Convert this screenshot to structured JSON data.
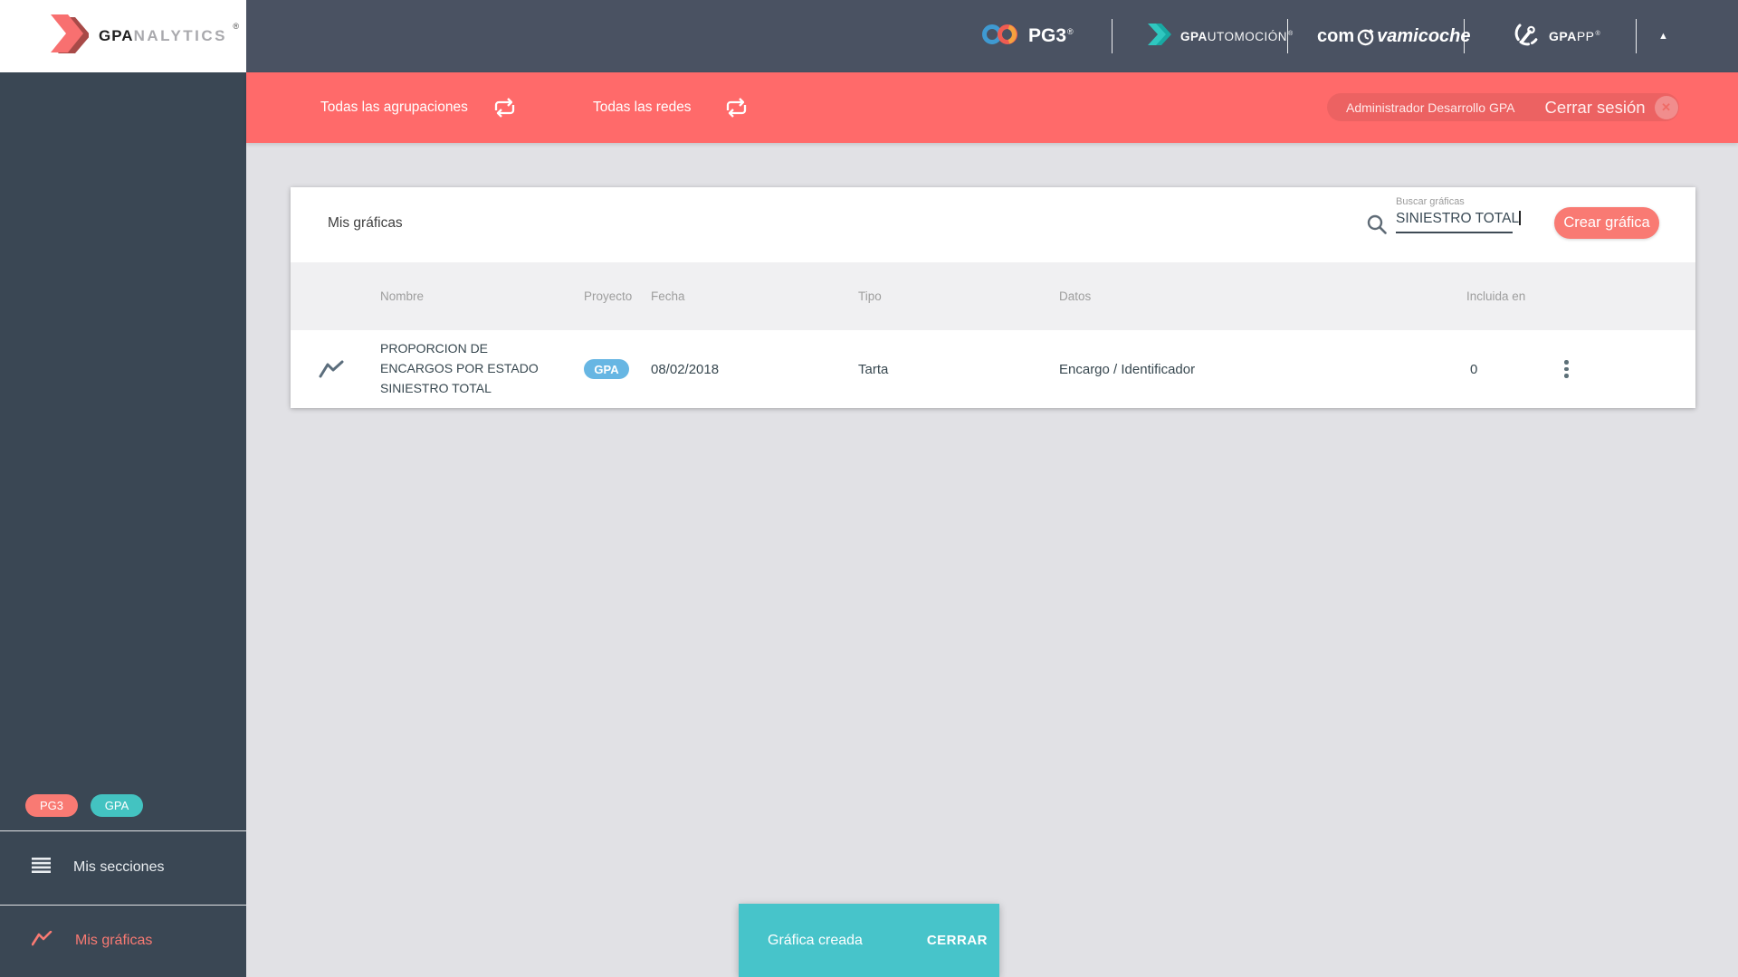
{
  "colors": {
    "coral": "#f97a73",
    "red": "#ff6a6a",
    "teal": "#43c3c1",
    "teal2": "#47c4ca",
    "blue": "#67b6e3"
  },
  "brand": {
    "gpa": "GPA",
    "nalytics": "NALYTICS",
    "reg": "®"
  },
  "topbar": {
    "pg3": "PG3",
    "pg3_reg": "®",
    "gpauto_bold": "GPA",
    "gpauto_thin": "UTOMOCIÓN",
    "gpauto_reg": "®",
    "comprava_pre": "com",
    "comprava_post": "vamicoche",
    "gpapp_bold": "GPA",
    "gpapp_thin": "PP",
    "gpapp_reg": "®",
    "collapse_icon": "▲"
  },
  "filterbar": {
    "groupings_label": "Todas las agrupaciones",
    "networks_label": "Todas las redes",
    "user_name": "Administrador Desarrollo GPA",
    "logout_label": "Cerrar sesión",
    "close_x": "✕"
  },
  "sidebar": {
    "badges": [
      {
        "label": "PG3"
      },
      {
        "label": "GPA"
      }
    ],
    "items": [
      {
        "label": "Mis secciones"
      },
      {
        "label": "Mis gráficas"
      }
    ]
  },
  "main": {
    "title": "Mis gráficas",
    "search": {
      "label": "Buscar gráficas",
      "value": "SINIESTRO TOTAL"
    },
    "create_button": "Crear gráfica",
    "table": {
      "headers": [
        "Nombre",
        "Proyecto",
        "Fecha",
        "Tipo",
        "Datos",
        "Incluida en"
      ],
      "rows": [
        {
          "name": "PROPORCION DE ENCARGOS POR ESTADO SINIESTRO TOTAL",
          "project": "GPA",
          "date": "08/02/2018",
          "type": "Tarta",
          "data": "Encargo / Identificador",
          "included_in": "0"
        }
      ]
    }
  },
  "snackbar": {
    "message": "Gráfica creada",
    "action": "CERRAR"
  }
}
